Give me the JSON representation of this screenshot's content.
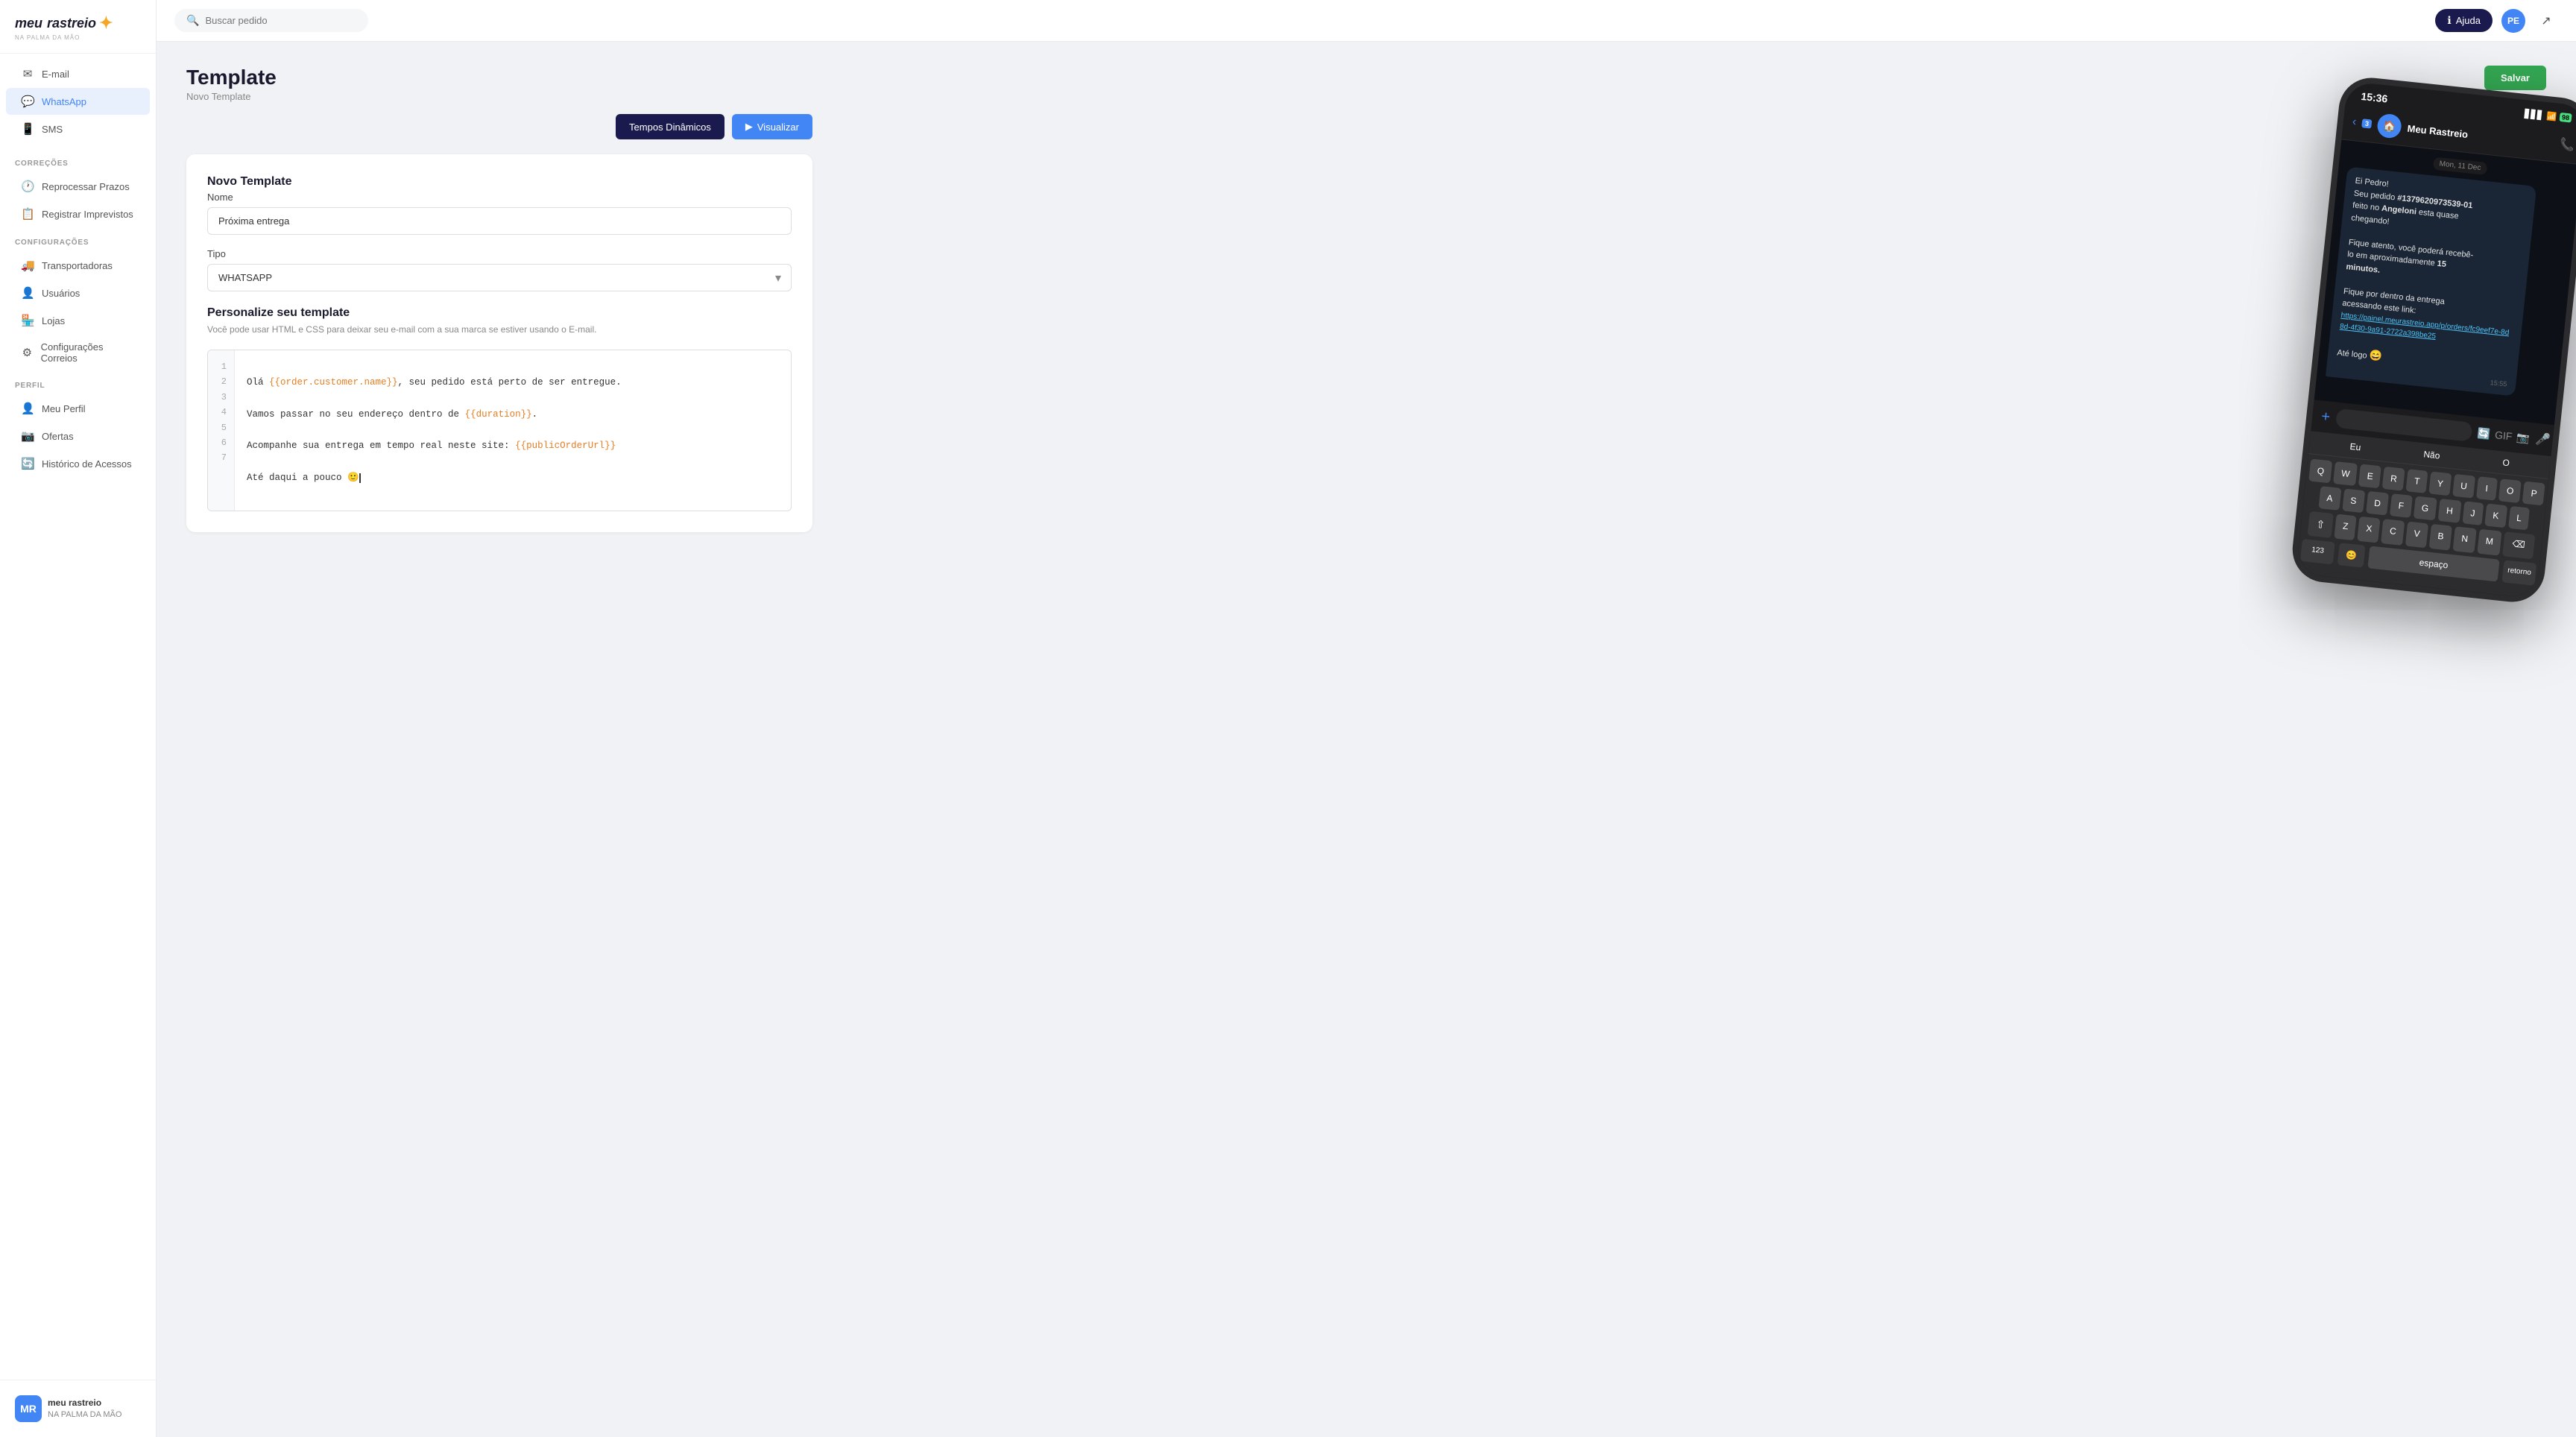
{
  "app": {
    "name": "Meu Rastreio",
    "logo_text_meu": "meu",
    "logo_text_rastreio": "rastreio",
    "subtitle": "NA PALMA DA MÃO"
  },
  "topbar": {
    "search_placeholder": "Buscar pedido",
    "help_label": "Ajuda",
    "avatar_initials": "PE"
  },
  "sidebar": {
    "sections": [
      {
        "label": "",
        "items": [
          {
            "id": "email",
            "label": "E-mail",
            "icon": "✉"
          },
          {
            "id": "whatsapp",
            "label": "WhatsApp",
            "icon": "💬",
            "active": true
          },
          {
            "id": "sms",
            "label": "SMS",
            "icon": "📱"
          }
        ]
      },
      {
        "label": "CORREÇÕES",
        "items": [
          {
            "id": "reprocessar",
            "label": "Reprocessar Prazos",
            "icon": "🕐"
          },
          {
            "id": "registrar",
            "label": "Registrar Imprevistos",
            "icon": "📋"
          }
        ]
      },
      {
        "label": "CONFIGURAÇÕES",
        "items": [
          {
            "id": "transportadoras",
            "label": "Transportadoras",
            "icon": "🚚"
          },
          {
            "id": "usuarios",
            "label": "Usuários",
            "icon": "👤"
          },
          {
            "id": "lojas",
            "label": "Lojas",
            "icon": "🏪"
          },
          {
            "id": "configuracoes",
            "label": "Configurações Correios",
            "icon": "⚙"
          }
        ]
      },
      {
        "label": "PERFIL",
        "items": [
          {
            "id": "meu-perfil",
            "label": "Meu Perfil",
            "icon": "👤"
          },
          {
            "id": "ofertas",
            "label": "Ofertas",
            "icon": "📷"
          },
          {
            "id": "historico",
            "label": "Histórico de Acessos",
            "icon": "🔄"
          }
        ]
      }
    ]
  },
  "page": {
    "title": "Template",
    "breadcrumb": "Novo Template"
  },
  "form": {
    "section_title": "Novo Template",
    "name_label": "Nome",
    "name_value": "Próxima entrega",
    "type_label": "Tipo",
    "type_value": "WHATSAPP",
    "customize_title": "Personalize seu template",
    "customize_desc": "Você pode usar HTML e CSS para deixar seu e-mail com a sua marca se estiver usando o E-mail."
  },
  "code_editor": {
    "lines": [
      {
        "num": "1",
        "content": "Olá {{order.customer.name}}, seu pedido está perto de ser entregue."
      },
      {
        "num": "2",
        "content": ""
      },
      {
        "num": "3",
        "content": "Vamos passar no seu endereço dentro de {{duration}}."
      },
      {
        "num": "4",
        "content": ""
      },
      {
        "num": "5",
        "content": "Acompanhe sua entrega em tempo real neste site: {{publicOrderUrl}}"
      },
      {
        "num": "6",
        "content": ""
      },
      {
        "num": "7",
        "content": "Até daqui a pouco 🙂"
      }
    ]
  },
  "actions": {
    "dynamic_label": "Tempos Dinâmicos",
    "visualize_label": "Visualizar",
    "save_label": "Salvar"
  },
  "phone": {
    "status_time": "15:36",
    "signal_bars": "▋▋▋",
    "wifi_icon": "WiFi",
    "battery": "98",
    "contact_name": "Meu Rastreio",
    "back_badge": "3",
    "date_label": "Mon, 11 Dec",
    "message_time": "15:55",
    "message_lines": [
      "Ei Pedro!",
      "Seu pedido #1379620973539-01",
      "feito no Angeloni esta quase",
      "chegando!",
      "",
      "Fique atento, você poderá recebê-",
      "lo em aproximadamente 15",
      "minutos.",
      "",
      "Fique por dentro da entrega",
      "acessando este link:"
    ],
    "link": "https://painel.meurastreio.app/p/orders/fc9eef7e-8d8d-4f30-9a91-2722a398be25",
    "sign_off": "Até logo 😄",
    "suggestions": [
      "Eu",
      "Não",
      "O"
    ],
    "keyboard_rows": [
      [
        "Q",
        "W",
        "E",
        "R",
        "T",
        "Y",
        "U",
        "I",
        "O",
        "P"
      ],
      [
        "A",
        "S",
        "D",
        "F",
        "G",
        "H",
        "J",
        "K",
        "L"
      ],
      [
        "Z",
        "X",
        "C",
        "V",
        "B",
        "N",
        "M"
      ],
      [
        "123",
        "😊",
        "espaço",
        "retorno"
      ]
    ]
  }
}
